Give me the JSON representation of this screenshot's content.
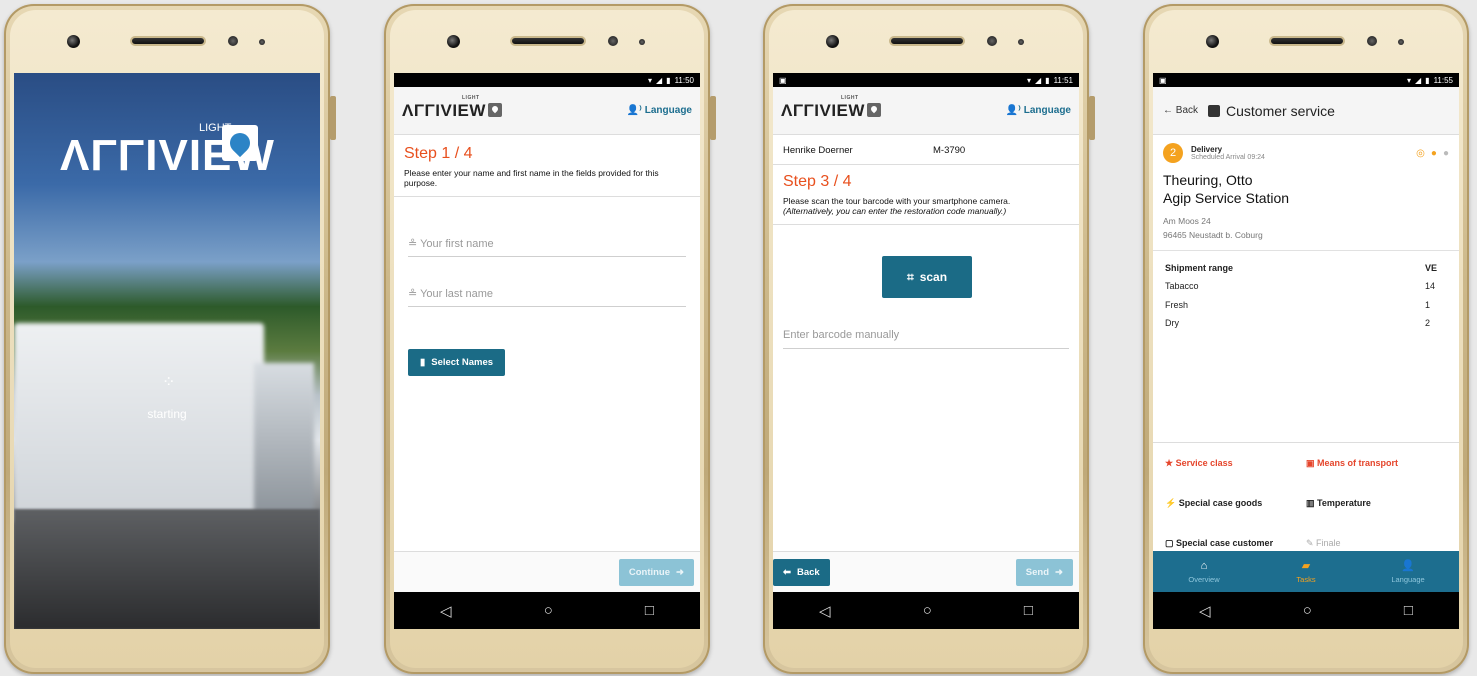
{
  "screen1": {
    "brand": "ΛΓΓIVIEW",
    "brand_light": "LIGHT",
    "spinner": "⁘",
    "status": "starting"
  },
  "screen2": {
    "time": "11:50",
    "brand": "ΛΓΓIVIEW",
    "brand_light": "LIGHT",
    "language": "Language",
    "step": "Step 1 / 4",
    "description": "Please enter your name and first name in the fields provided for this purpose.",
    "first_name_placeholder": "Your first name",
    "last_name_placeholder": "Your last name",
    "select_names": "Select Names",
    "continue": "Continue"
  },
  "screen3": {
    "time": "11:51",
    "brand": "ΛΓΓIVIEW",
    "brand_light": "LIGHT",
    "language": "Language",
    "driver_name": "Henrike Doerner",
    "driver_id": "M-3790",
    "step": "Step 3 / 4",
    "description": "Please scan the tour barcode with your smartphone camera.",
    "description_italic": "(Alternatively, you can enter the restoration code manually.)",
    "scan": "scan",
    "barcode_placeholder": "Enter barcode manually",
    "back": "Back",
    "send": "Send"
  },
  "screen4": {
    "time": "11:55",
    "back": "Back",
    "title": "Customer service",
    "stop_number": "2",
    "delivery": "Delivery",
    "scheduled": "Scheduled Arrival 09:24",
    "customer_name": "Theuring, Otto",
    "company": "Agip Service Station",
    "street": "Am Moos 24",
    "city": "96465 Neustadt b. Coburg",
    "shipment_header": "Shipment range",
    "shipment_unit": "VE",
    "shipments": [
      {
        "name": "Tabacco",
        "value": "14"
      },
      {
        "name": "Fresh",
        "value": "1"
      },
      {
        "name": "Dry",
        "value": "2"
      }
    ],
    "options": {
      "service_class": "Service class",
      "means_of_transport": "Means of transport",
      "special_goods": "Special case goods",
      "temperature": "Temperature",
      "special_customer": "Special case customer",
      "finale": "Finale"
    },
    "tabs": {
      "overview": "Overview",
      "tasks": "Tasks",
      "language": "Language"
    }
  },
  "colors": {
    "teal": "#1b6b86",
    "orange_red": "#e8501e",
    "amber": "#f4a21f"
  }
}
